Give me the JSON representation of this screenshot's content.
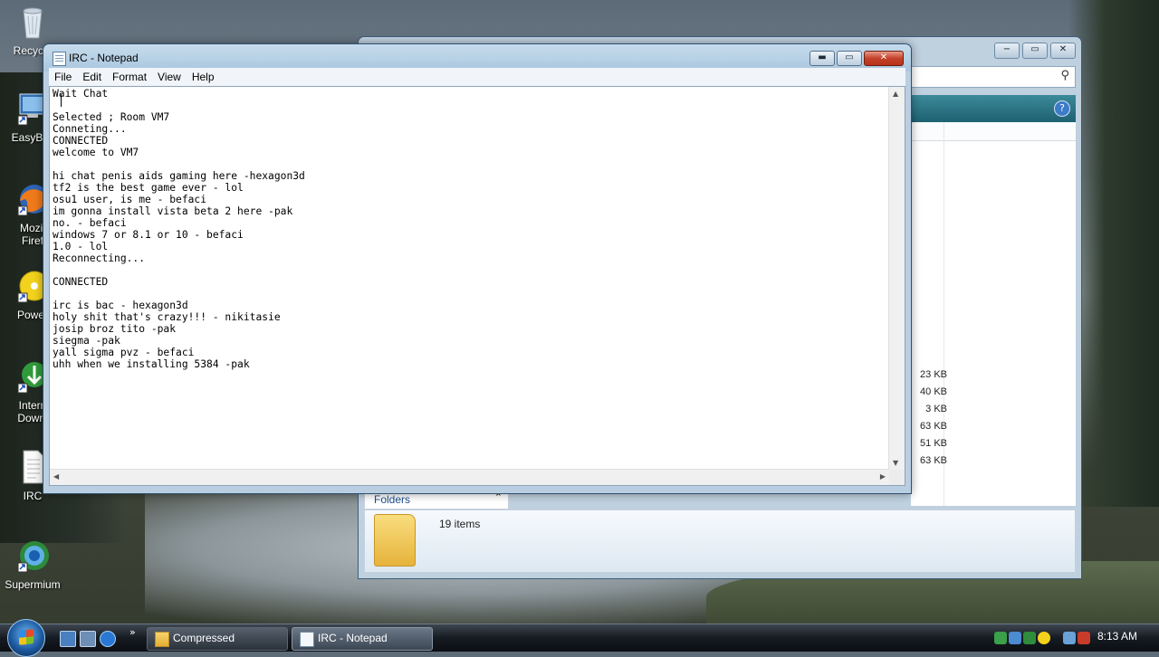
{
  "desktop": {
    "icons": [
      {
        "label": "Recycle",
        "icon": "recycle-bin-icon"
      },
      {
        "label": "EasyBCI",
        "icon": "easybcd-icon"
      },
      {
        "label": "Mozil",
        "label2": "Firef",
        "icon": "firefox-icon"
      },
      {
        "label": "Power",
        "icon": "power-dvd-icon"
      },
      {
        "label": "Intern",
        "label2": "Downl",
        "icon": "internet-download-manager-icon"
      },
      {
        "label": "IRC",
        "icon": "text-file-icon"
      },
      {
        "label": "Supermium",
        "icon": "supermium-browser-icon"
      }
    ]
  },
  "explorer": {
    "title_buttons": [
      "−",
      "▭",
      "✕"
    ],
    "help": "?",
    "sizes": [
      "23 KB",
      "40 KB",
      "3 KB",
      "63 KB",
      "51 KB",
      "63 KB"
    ],
    "folders_label": "Folders",
    "items_count": "19 items"
  },
  "notepad": {
    "title": "IRC - Notepad",
    "controls": {
      "min": "▬",
      "max": "▭",
      "close": "✕"
    },
    "menu": [
      "File",
      "Edit",
      "Format",
      "View",
      "Help"
    ],
    "content": "Wait Chat\n\nSelected ; Room VM7\nConneting...\nCONNECTED\nwelcome to VM7\n\nhi chat penis aids gaming here -hexagon3d\ntf2 is the best game ever - lol\nosu1 user, is me - befaci\nim gonna install vista beta 2 here -pak\nno. - befaci\nwindows 7 or 8.1 or 10 - befaci\n1.0 - lol\nReconnecting...\n\nCONNECTED\n\nirc is bac - hexagon3d\nholy shit that's crazy!!! - nikitasie\njosip broz tito -pak\nsiegma -pak\nyall sigma pvz - befaci\nuhh when we installing 5384 -pak"
  },
  "taskbar": {
    "quicklaunch_more": "»",
    "tasks": [
      {
        "label": "Compressed",
        "icon": "folder-icon",
        "active": false
      },
      {
        "label": "IRC - Notepad",
        "icon": "notepad-icon",
        "active": true
      }
    ],
    "clock": "8:13 AM"
  },
  "colors": {
    "taskbar": "#161b22",
    "title_close": "#c3412a",
    "window_frame": "#a9c6de"
  }
}
